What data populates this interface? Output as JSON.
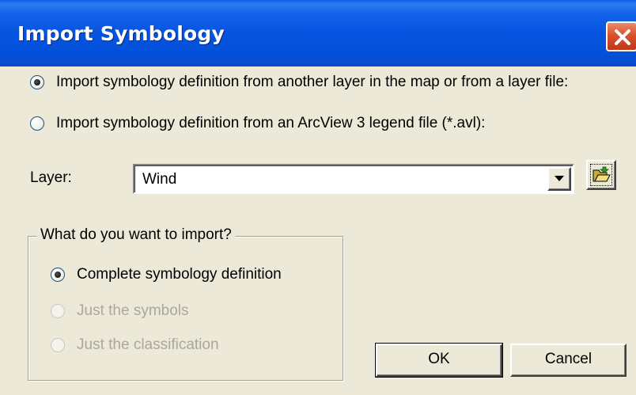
{
  "window": {
    "title": "Import Symbology",
    "close_icon": "close-icon"
  },
  "options": {
    "from_layer_label": "Import symbology definition from another layer in the map or from a layer file:",
    "from_legend_label": "Import symbology definition from an ArcView 3 legend file (*.avl):",
    "selected": "from_layer"
  },
  "layer": {
    "label": "Layer:",
    "value": "Wind",
    "dropdown_icon": "chevron-down-icon",
    "browse_icon": "folder-open-icon"
  },
  "import_group": {
    "label": "What do you want to import?",
    "complete_label": "Complete symbology definition",
    "symbols_label": "Just the symbols",
    "classification_label": "Just the classification",
    "selected": "complete"
  },
  "buttons": {
    "ok_label": "OK",
    "cancel_label": "Cancel"
  },
  "colors": {
    "titlebar": "#0553e0",
    "dialog_bg": "#ece9d8",
    "close_button": "#d8512c",
    "disabled_text": "#aca899"
  }
}
